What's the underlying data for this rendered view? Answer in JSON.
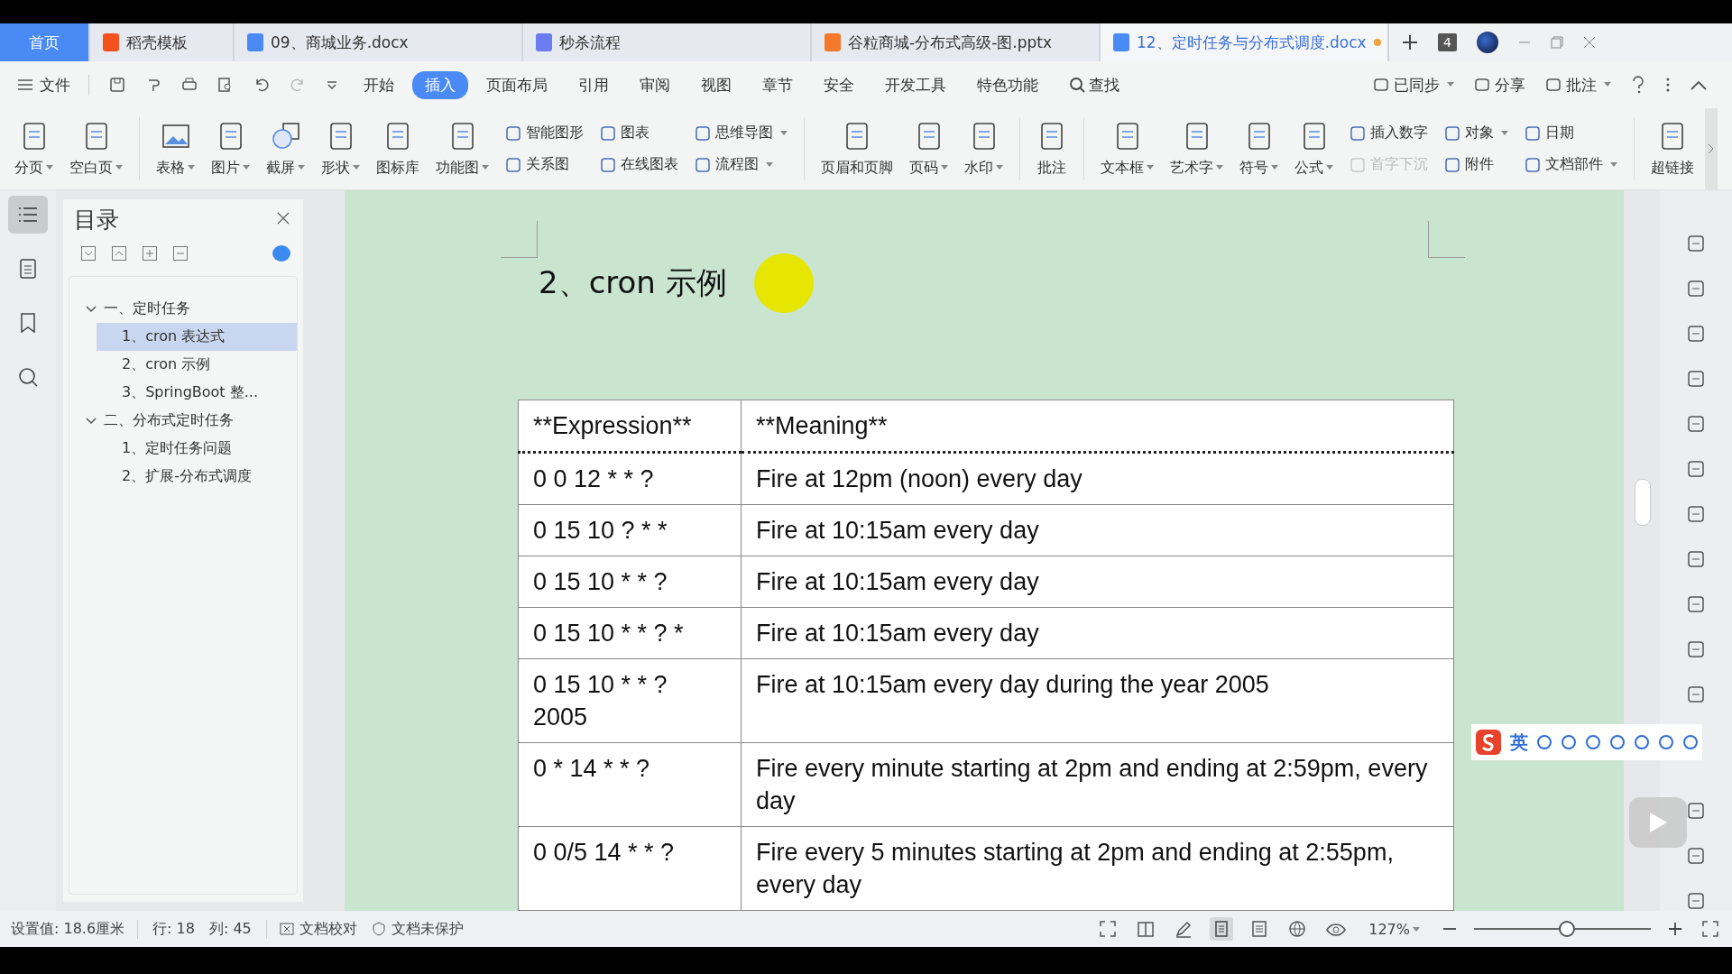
{
  "tabs": [
    {
      "label": "首页",
      "kind": "home",
      "selected": false
    },
    {
      "label": "稻壳模板",
      "kind": "docer",
      "selected": false,
      "modified": false
    },
    {
      "label": "09、商城业务.docx",
      "kind": "word",
      "selected": false,
      "modified": false
    },
    {
      "label": "秒杀流程",
      "kind": "flow",
      "selected": false,
      "modified": false
    },
    {
      "label": "谷粒商城-分布式高级-图.pptx",
      "kind": "ppt",
      "selected": false,
      "modified": false
    },
    {
      "label": "12、定时任务与分布式调度.docx",
      "kind": "word",
      "selected": true,
      "modified": true
    }
  ],
  "tab_count": "4",
  "menu": {
    "file": "文件",
    "items": [
      {
        "label": "开始",
        "selected": false
      },
      {
        "label": "插入",
        "selected": true
      },
      {
        "label": "页面布局",
        "selected": false
      },
      {
        "label": "引用",
        "selected": false
      },
      {
        "label": "审阅",
        "selected": false
      },
      {
        "label": "视图",
        "selected": false
      },
      {
        "label": "章节",
        "selected": false
      },
      {
        "label": "安全",
        "selected": false
      },
      {
        "label": "开发工具",
        "selected": false
      },
      {
        "label": "特色功能",
        "selected": false
      }
    ],
    "search": "查找",
    "right": [
      {
        "label": "已同步",
        "dropdown": true
      },
      {
        "label": "分享",
        "dropdown": false
      },
      {
        "label": "批注",
        "dropdown": true
      }
    ]
  },
  "ribbon": [
    {
      "kind": "large",
      "label": "分页",
      "dropdown": true
    },
    {
      "kind": "large",
      "label": "空白页",
      "dropdown": true
    },
    {
      "kind": "separator"
    },
    {
      "kind": "large",
      "label": "表格",
      "dropdown": true
    },
    {
      "kind": "large",
      "label": "图片",
      "dropdown": true
    },
    {
      "kind": "large",
      "label": "截屏",
      "dropdown": true
    },
    {
      "kind": "large",
      "label": "形状",
      "dropdown": true
    },
    {
      "kind": "large",
      "label": "图标库",
      "dropdown": false
    },
    {
      "kind": "large",
      "label": "功能图",
      "dropdown": true
    },
    {
      "kind": "stack",
      "items": [
        {
          "label": "智能图形",
          "dropdown": false,
          "disabled": false
        },
        {
          "label": "关系图",
          "dropdown": false,
          "disabled": false
        }
      ]
    },
    {
      "kind": "stack",
      "items": [
        {
          "label": "图表",
          "dropdown": false,
          "disabled": false
        },
        {
          "label": "在线图表",
          "dropdown": false,
          "disabled": false
        }
      ]
    },
    {
      "kind": "stack",
      "items": [
        {
          "label": "思维导图",
          "dropdown": true,
          "disabled": false
        },
        {
          "label": "流程图",
          "dropdown": true,
          "disabled": false
        }
      ]
    },
    {
      "kind": "separator"
    },
    {
      "kind": "large",
      "label": "页眉和页脚",
      "dropdown": false
    },
    {
      "kind": "large",
      "label": "页码",
      "dropdown": true
    },
    {
      "kind": "large",
      "label": "水印",
      "dropdown": true
    },
    {
      "kind": "separator"
    },
    {
      "kind": "large",
      "label": "批注",
      "dropdown": false
    },
    {
      "kind": "separator"
    },
    {
      "kind": "large",
      "label": "文本框",
      "dropdown": true
    },
    {
      "kind": "large",
      "label": "艺术字",
      "dropdown": true
    },
    {
      "kind": "large",
      "label": "符号",
      "dropdown": true
    },
    {
      "kind": "large",
      "label": "公式",
      "dropdown": true
    },
    {
      "kind": "stack",
      "items": [
        {
          "label": "插入数字",
          "dropdown": false,
          "disabled": false
        },
        {
          "label": "首字下沉",
          "dropdown": false,
          "disabled": true
        }
      ]
    },
    {
      "kind": "stack",
      "items": [
        {
          "label": "对象",
          "dropdown": true,
          "disabled": false
        },
        {
          "label": "附件",
          "dropdown": false,
          "disabled": false
        }
      ]
    },
    {
      "kind": "stack",
      "items": [
        {
          "label": "日期",
          "dropdown": false,
          "disabled": false
        },
        {
          "label": "文档部件",
          "dropdown": true,
          "disabled": false
        }
      ]
    },
    {
      "kind": "separator"
    },
    {
      "kind": "large",
      "label": "超链接",
      "dropdown": false
    }
  ],
  "outline": {
    "title": "目录",
    "items": [
      {
        "label": "一、定时任务",
        "expanded": true,
        "selected": false,
        "children": [
          {
            "label": "1、cron 表达式",
            "selected": true
          },
          {
            "label": "2、cron 示例",
            "selected": false
          },
          {
            "label": "3、SpringBoot 整...",
            "selected": false
          }
        ]
      },
      {
        "label": "二、分布式定时任务",
        "expanded": true,
        "selected": false,
        "children": [
          {
            "label": "1、定时任务问题",
            "selected": false
          },
          {
            "label": "2、扩展-分布式调度",
            "selected": false
          }
        ]
      }
    ]
  },
  "document": {
    "heading": "2、cron 示例",
    "table": {
      "columns": [
        "**Expression**",
        "**Meaning**"
      ],
      "rows": [
        [
          "0 0 12 * * ?",
          "Fire at 12pm (noon) every day"
        ],
        [
          "0 15 10 ? * *",
          "Fire at 10:15am every day"
        ],
        [
          "0 15 10 * * ?",
          "Fire at 10:15am every day"
        ],
        [
          "0 15 10 * * ? *",
          "Fire at 10:15am every day"
        ],
        [
          "0 15 10 * * ? 2005",
          "Fire at 10:15am every day during the year 2005"
        ],
        [
          "0 * 14 * * ?",
          "Fire every minute starting at 2pm and ending at 2:59pm, every day"
        ],
        [
          "0 0/5 14 * * ?",
          "Fire every 5 minutes starting at 2pm and ending at 2:55pm, every day"
        ]
      ]
    }
  },
  "ime": {
    "mode": "英"
  },
  "status_bar": {
    "left": [
      "设置值: 18.6厘米",
      "行: 18",
      "列: 45"
    ],
    "proofing": "文档校对",
    "protection": "文档未保护",
    "zoom": "127%",
    "zoom_level": {
      "level": 0.52
    }
  }
}
